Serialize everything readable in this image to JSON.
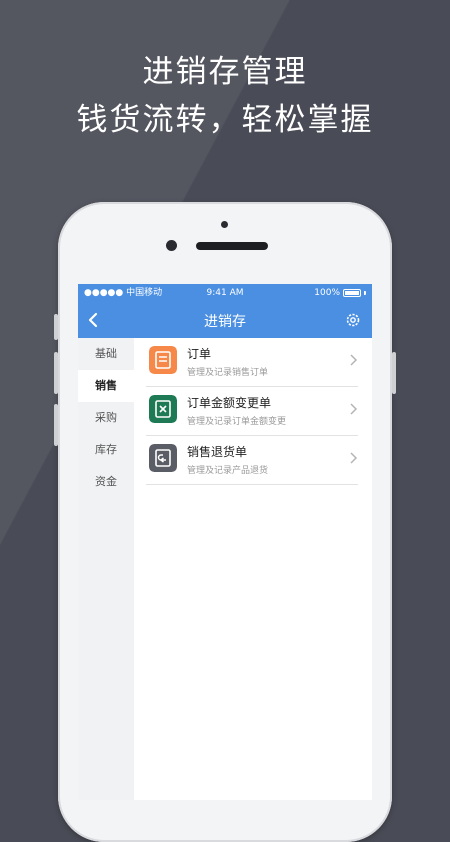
{
  "promo": {
    "line1": "进销存管理",
    "line2": "钱货流转，轻松掌握"
  },
  "statusbar": {
    "carrier": "●●●●● 中国移动",
    "time": "9:41 AM",
    "battery": "100%"
  },
  "navbar": {
    "title": "进销存"
  },
  "sidebar": {
    "items": [
      {
        "label": "基础",
        "active": false
      },
      {
        "label": "销售",
        "active": true
      },
      {
        "label": "采购",
        "active": false
      },
      {
        "label": "库存",
        "active": false
      },
      {
        "label": "资金",
        "active": false
      }
    ]
  },
  "list": {
    "items": [
      {
        "title": "订单",
        "subtitle": "管理及记录销售订单",
        "icon": "order-icon",
        "color": "#f6894a"
      },
      {
        "title": "订单金额变更单",
        "subtitle": "管理及记录订单金额变更",
        "icon": "amount-change-icon",
        "color": "#1d7a55"
      },
      {
        "title": "销售退货单",
        "subtitle": "管理及记录产品退货",
        "icon": "return-icon",
        "color": "#5a5d66"
      }
    ]
  },
  "colors": {
    "accent": "#4a8fe2",
    "background": "#494b56"
  }
}
